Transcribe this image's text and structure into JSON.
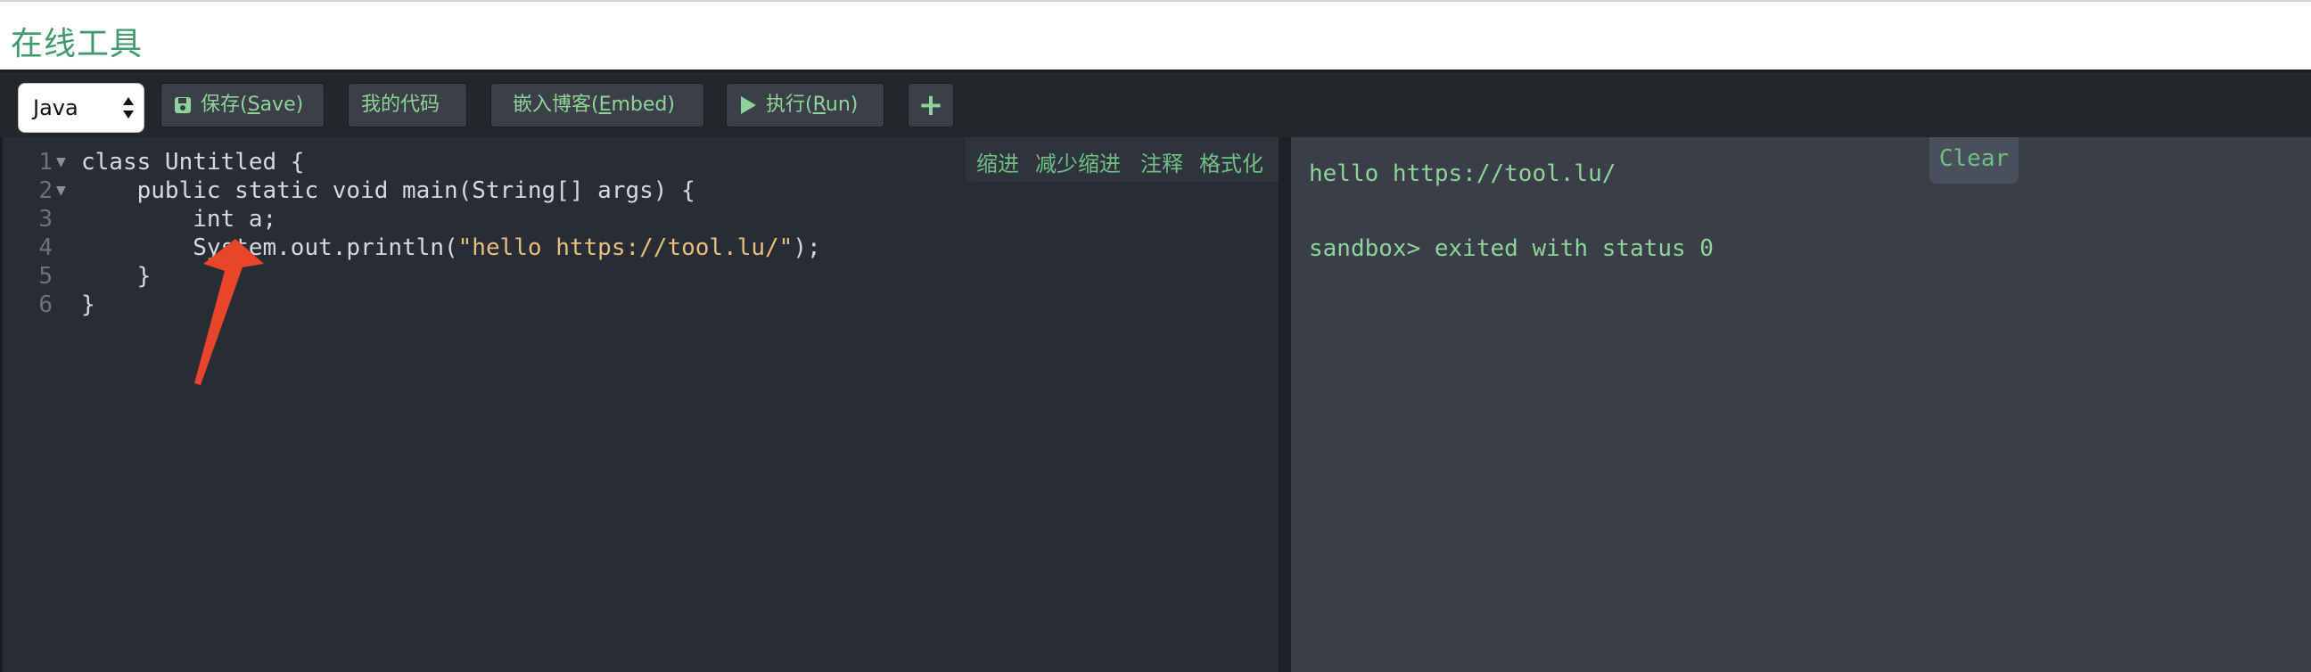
{
  "header": {
    "title": "在线工具"
  },
  "toolbar": {
    "language": "Java",
    "save_label": "保存(Save)",
    "my_code_label": "我的代码",
    "embed_label": "嵌入博客(Embed)",
    "run_label": "执行(Run)",
    "add_label": "+"
  },
  "editor": {
    "tools": [
      "缩进",
      "减少缩进",
      "注释",
      "格式化"
    ],
    "line_numbers": [
      "1",
      "2",
      "3",
      "4",
      "5",
      "6"
    ],
    "lines": [
      "class Untitled {",
      "    public static void main(String[] args) {",
      "        int a;",
      "        System.out.println(\"hello https://tool.lu/\");",
      "    }",
      "}"
    ]
  },
  "output": {
    "clear_label": "Clear",
    "lines": [
      "hello https://tool.lu/",
      "",
      "sandbox> exited with status 0"
    ]
  },
  "colors": {
    "accent_green": "#8fd39a",
    "title_green": "#3f9a6b",
    "editor_bg": "#282c34",
    "output_bg": "#393e48",
    "arrow_red": "#e8452a"
  },
  "icons": [
    "save-icon",
    "play-icon",
    "plus-icon",
    "select-arrows-icon",
    "fold-arrow-icon"
  ]
}
